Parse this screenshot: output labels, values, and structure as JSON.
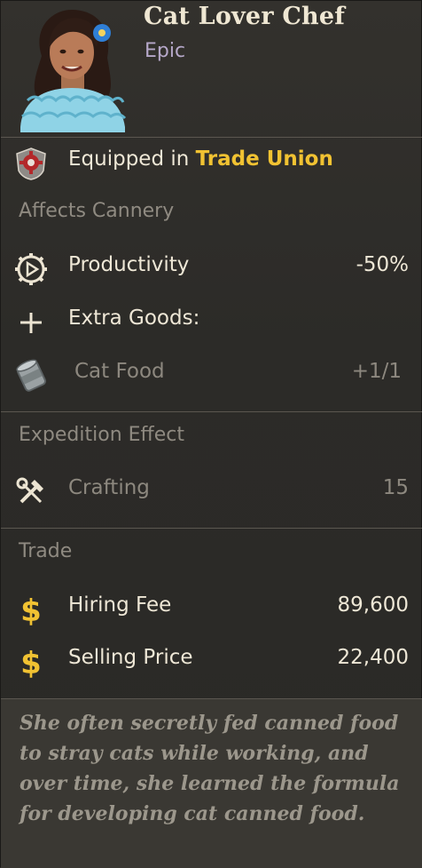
{
  "character": {
    "name": "Cat Lover Chef",
    "rarity": "Epic"
  },
  "equipped": {
    "prefix": "Equipped in ",
    "location": "Trade Union"
  },
  "affects": {
    "title": "Affects Cannery",
    "productivity": {
      "label": "Productivity",
      "value": "-50%"
    },
    "extra_goods": {
      "label": "Extra Goods:"
    },
    "cat_food": {
      "label": "Cat Food",
      "value": "+1/1"
    }
  },
  "expedition": {
    "title": "Expedition Effect",
    "crafting": {
      "label": "Crafting",
      "value": "15"
    }
  },
  "trade": {
    "title": "Trade",
    "hiring_fee": {
      "label": "Hiring Fee",
      "value": "89,600"
    },
    "selling_price": {
      "label": "Selling Price",
      "value": "22,400"
    }
  },
  "description": "She often secretly fed canned food to stray cats while working, and over time, she learned the formula for developing cat canned food.",
  "colors": {
    "accent_gold": "#f1c232",
    "rarity_purple": "#b6a8c9",
    "muted_text": "#8f8a81"
  },
  "icons": [
    "portrait",
    "trade-union-emblem-icon",
    "productivity-gear-icon",
    "plus-icon",
    "cat-food-can-icon",
    "crafting-tools-icon",
    "dollar-icon"
  ]
}
